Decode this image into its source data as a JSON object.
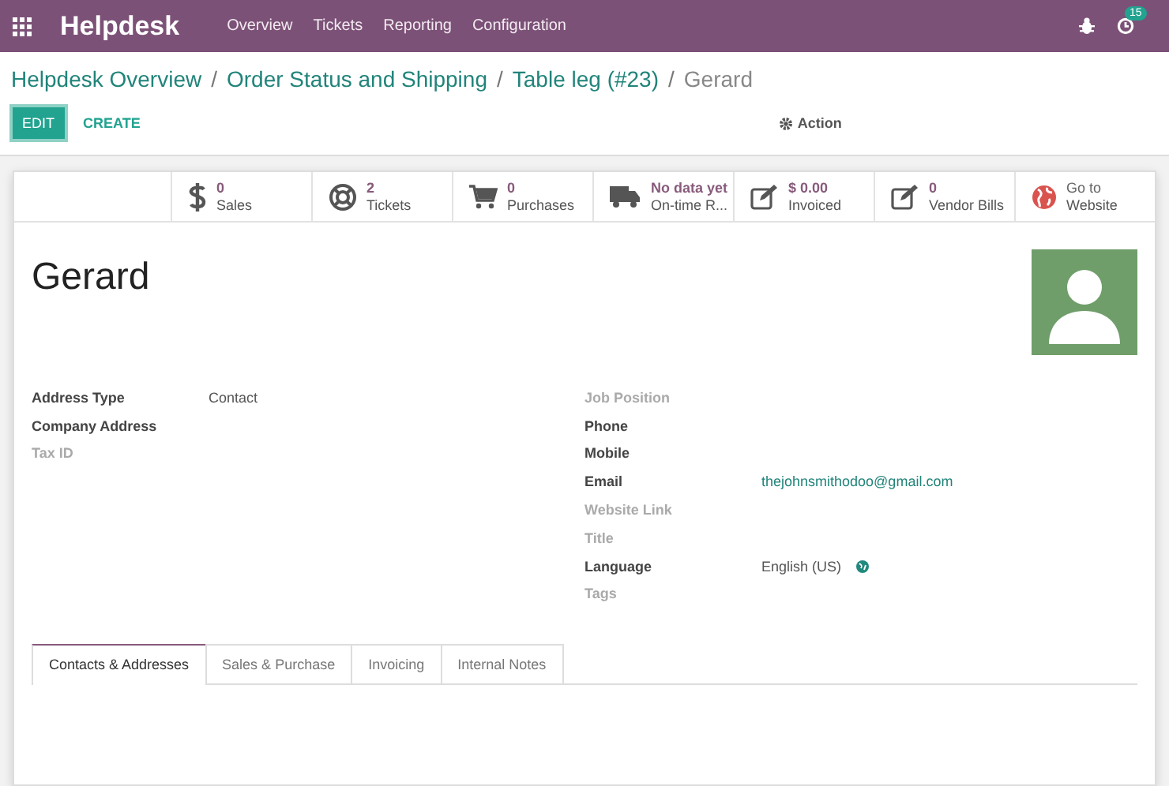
{
  "navbar": {
    "app_name": "Helpdesk",
    "menu": [
      "Overview",
      "Tickets",
      "Reporting",
      "Configuration"
    ],
    "activity_count": "15"
  },
  "breadcrumbs": [
    "Helpdesk Overview",
    "Order Status and Shipping",
    "Table leg (#23)",
    "Gerard"
  ],
  "breadcrumb_separators": [
    "/",
    "/",
    "/"
  ],
  "buttons": {
    "edit": "EDIT",
    "create": "CREATE",
    "action": "Action"
  },
  "stat_buttons": [
    {
      "kind": "dollar",
      "value": "0",
      "label": "Sales"
    },
    {
      "kind": "lifebuoy",
      "value": "2",
      "label": "Tickets"
    },
    {
      "kind": "cart",
      "value": "0",
      "label": "Purchases"
    },
    {
      "kind": "truck",
      "value": "No data yet",
      "label": "On-time R..."
    },
    {
      "kind": "edit",
      "value": "$ 0.00",
      "label": "Invoiced"
    },
    {
      "kind": "edit",
      "value": "0",
      "label": "Vendor Bills"
    },
    {
      "kind": "link",
      "value": "Go to",
      "label": "Website"
    }
  ],
  "name": "Gerard",
  "left_fields": [
    {
      "label": "Address Type",
      "filled": true,
      "value": "Contact"
    },
    {
      "label": "Company Address",
      "filled": true
    },
    {
      "label": "Tax ID",
      "filled": false
    }
  ],
  "right_fields": [
    {
      "label": "Job Position",
      "filled": false
    },
    {
      "label": "Phone",
      "filled": true
    },
    {
      "label": "Mobile",
      "filled": true
    },
    {
      "label": "Email",
      "filled": true,
      "value": "thejohnsmithodoo@gmail.com",
      "kind": "link"
    },
    {
      "label": "Website Link",
      "filled": false
    },
    {
      "label": "Title",
      "filled": false
    },
    {
      "label": "Language",
      "filled": true,
      "value": "English (US)",
      "kind": "language"
    },
    {
      "label": "Tags",
      "filled": false
    }
  ],
  "tabs": [
    {
      "label": "Contacts & Addresses",
      "selected": true
    },
    {
      "label": "Sales & Purchase",
      "selected": false
    },
    {
      "label": "Invoicing",
      "selected": false
    },
    {
      "label": "Internal Notes",
      "selected": false
    }
  ]
}
